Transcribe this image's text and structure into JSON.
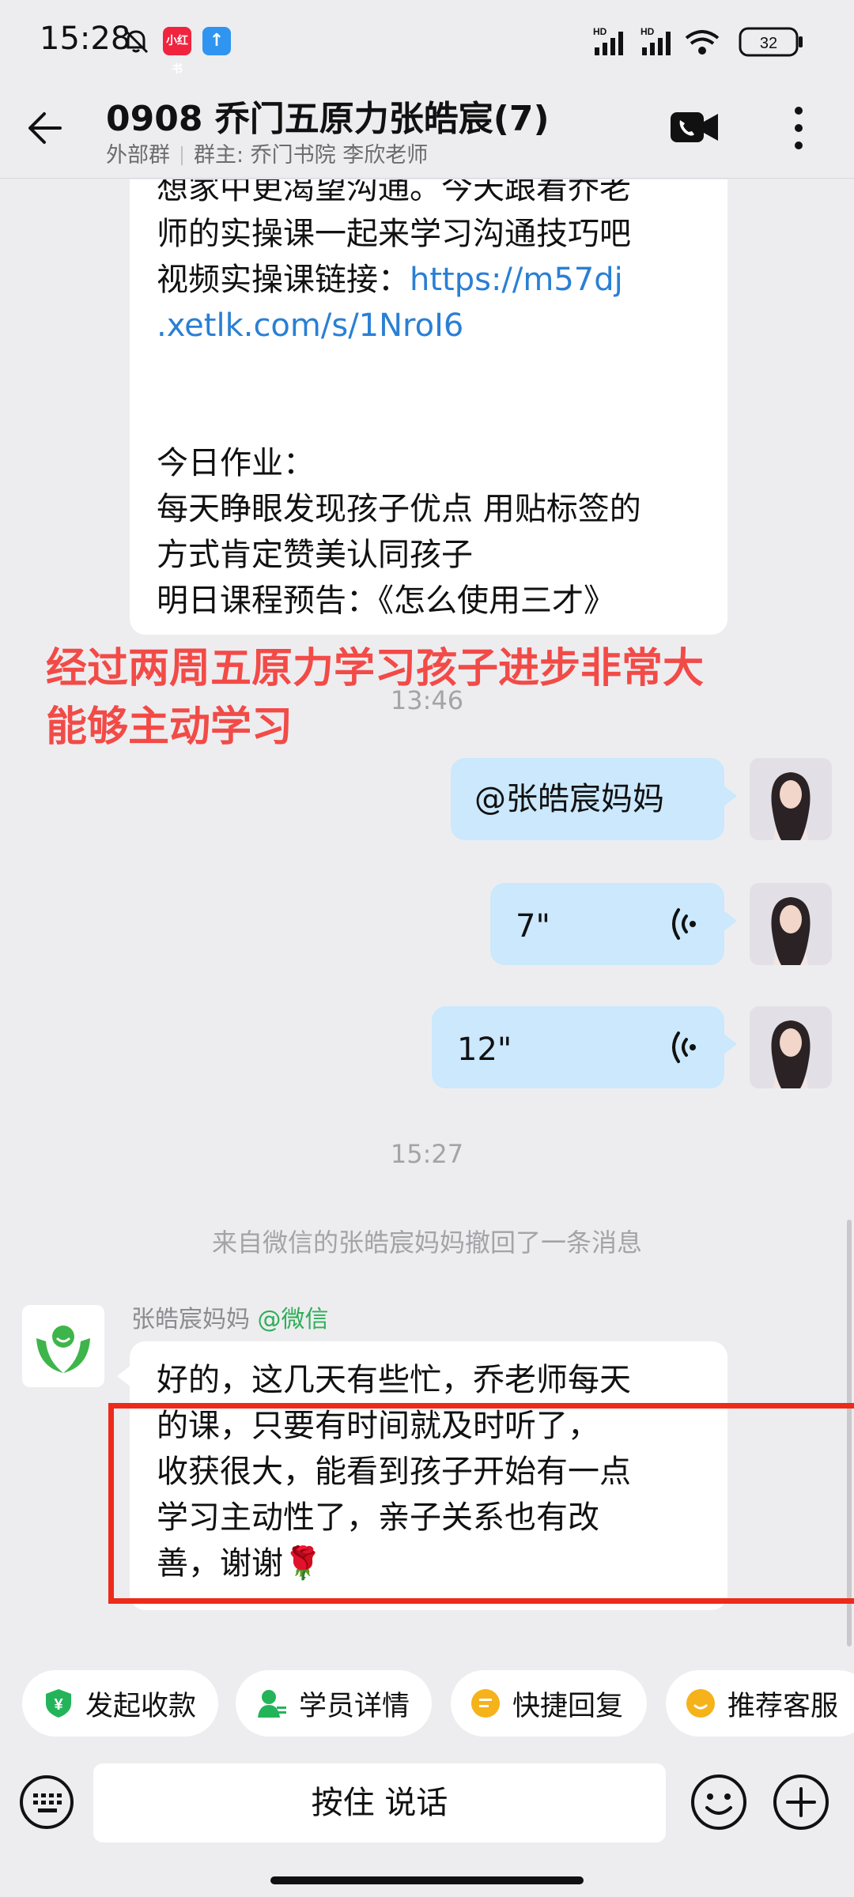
{
  "status_bar": {
    "time": "15:28",
    "app_icon_1": "小红书",
    "battery": "32",
    "network_1": "HD",
    "network_2": "HD"
  },
  "header": {
    "title": "0908 乔门五原力张皓宸(7)",
    "tag": "外部群",
    "owner": "群主: 乔门书院 李欣老师"
  },
  "messages": {
    "course_msg": {
      "line1": "想家中更渴望沟通。今天跟着乔老",
      "line2": "师的实操课一起来学习沟通技巧吧",
      "line3_prefix": "视频实操课链接：",
      "link1": "https://m57dj",
      "link2": ".xetlk.com/s/1NroI6",
      "hw_title": "今日作业：",
      "hw1": "每天睁眼发现孩子优点 用贴标签的",
      "hw2": "方式肯定赞美认同孩子",
      "preview": "明日课程预告：《怎么使用三才》"
    },
    "overlay": {
      "line1": "经过两周五原力学习孩子进步非常大",
      "line2": "能够主动学习"
    },
    "time1": "13:46",
    "mention": "@张皓宸妈妈",
    "voice1": "7\"",
    "voice2": "12\"",
    "time2": "15:27",
    "recall_notice": "来自微信的张皓宸妈妈撤回了一条消息",
    "sender_name": "张皓宸妈妈",
    "sender_source": "@微信",
    "reply": {
      "line1": "好的，这几天有些忙，乔老师每天",
      "line2": "的课，只要有时间就及时听了，",
      "line3": "收获很大，能看到孩子开始有一点",
      "line4": "学习主动性了，亲子关系也有改",
      "line5": "善，谢谢🌹"
    }
  },
  "quick_actions": [
    {
      "label": "发起收款",
      "icon": "payment-shield-icon",
      "color": "#23b45a"
    },
    {
      "label": "学员详情",
      "icon": "student-icon",
      "color": "#23b45a"
    },
    {
      "label": "快捷回复",
      "icon": "quick-reply-icon",
      "color": "#f6b21a"
    },
    {
      "label": "推荐客服",
      "icon": "service-icon",
      "color": "#f6b21a"
    }
  ],
  "input": {
    "hold_to_talk": "按住 说话"
  },
  "colors": {
    "accent_blue": "#2a7fd4",
    "bubble_blue": "#cbe8fd",
    "overlay_red": "#f24b47",
    "box_red": "#ee2a1a",
    "wechat_green": "#2fae58"
  }
}
